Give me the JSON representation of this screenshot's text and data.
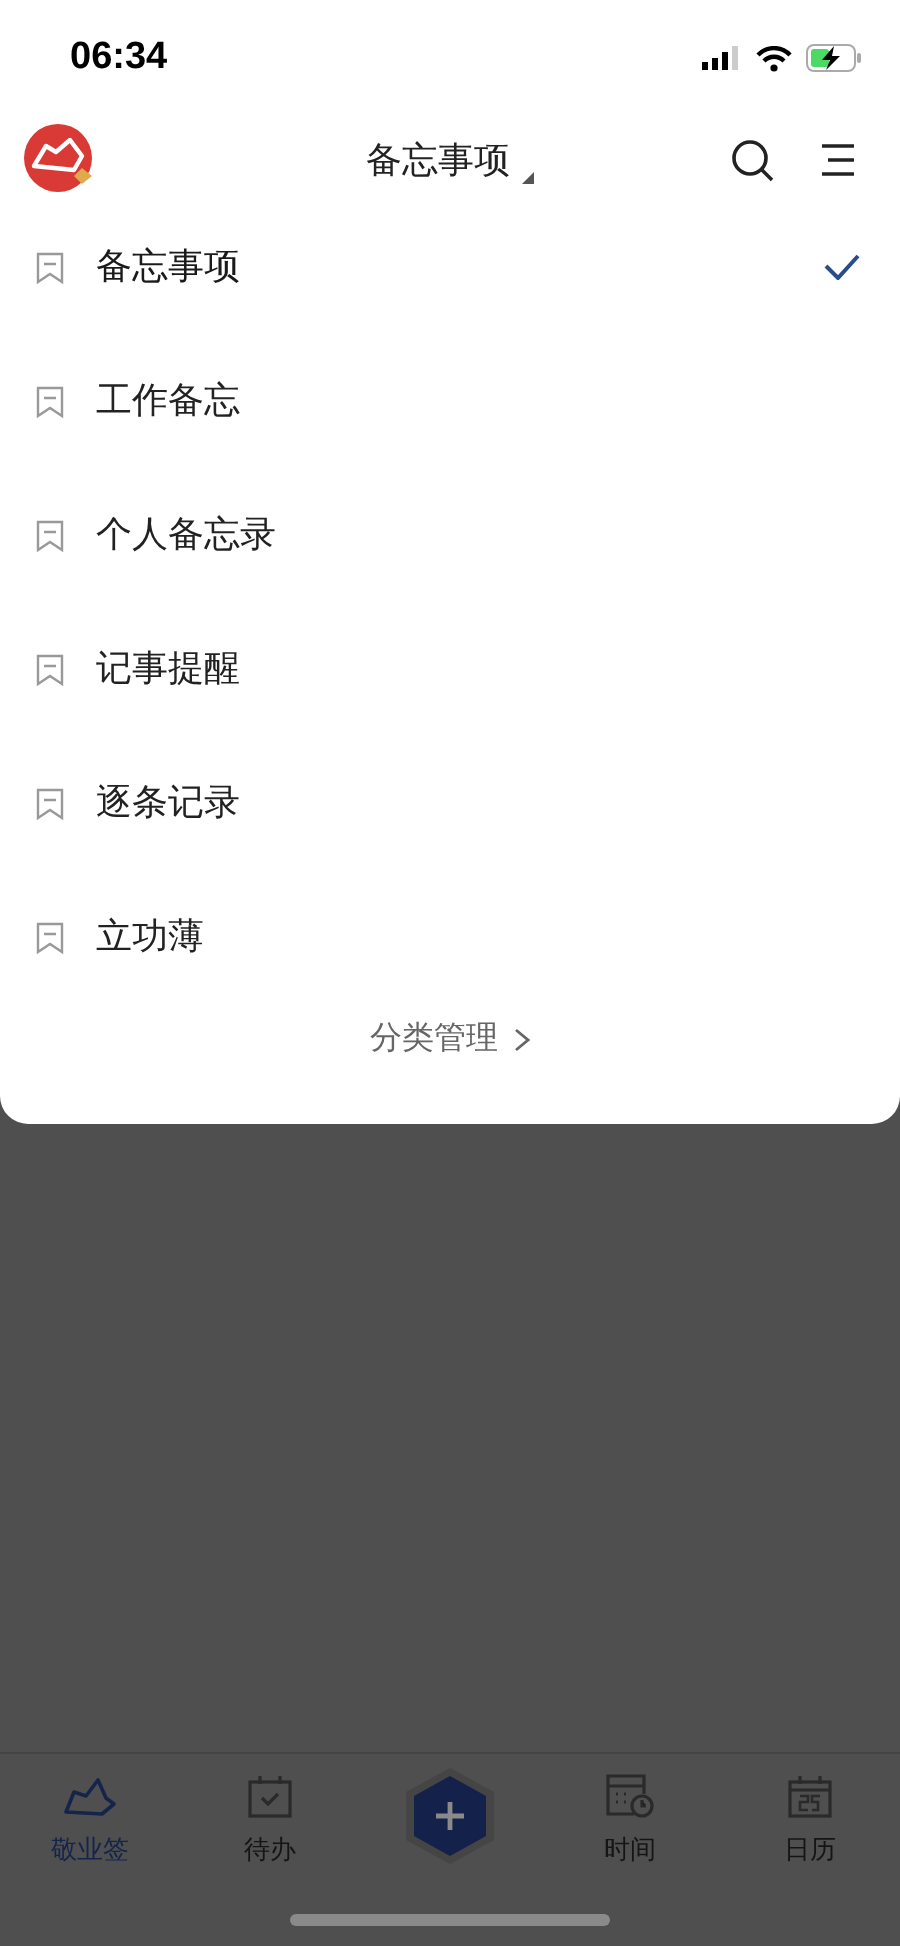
{
  "status_bar": {
    "time": "06:34"
  },
  "header": {
    "title": "备忘事项"
  },
  "categories": [
    {
      "label": "备忘事项",
      "selected": true
    },
    {
      "label": "工作备忘",
      "selected": false
    },
    {
      "label": "个人备忘录",
      "selected": false
    },
    {
      "label": "记事提醒",
      "selected": false
    },
    {
      "label": "逐条记录",
      "selected": false
    },
    {
      "label": "立功薄",
      "selected": false
    }
  ],
  "manage_link": {
    "label": "分类管理"
  },
  "tab_bar": [
    {
      "kind": "tab",
      "label": "敬业签",
      "selected": true
    },
    {
      "kind": "tab",
      "label": "待办",
      "selected": false
    },
    {
      "kind": "add"
    },
    {
      "kind": "tab",
      "label": "时间",
      "selected": false
    },
    {
      "kind": "tab",
      "label": "日历",
      "selected": false
    }
  ]
}
